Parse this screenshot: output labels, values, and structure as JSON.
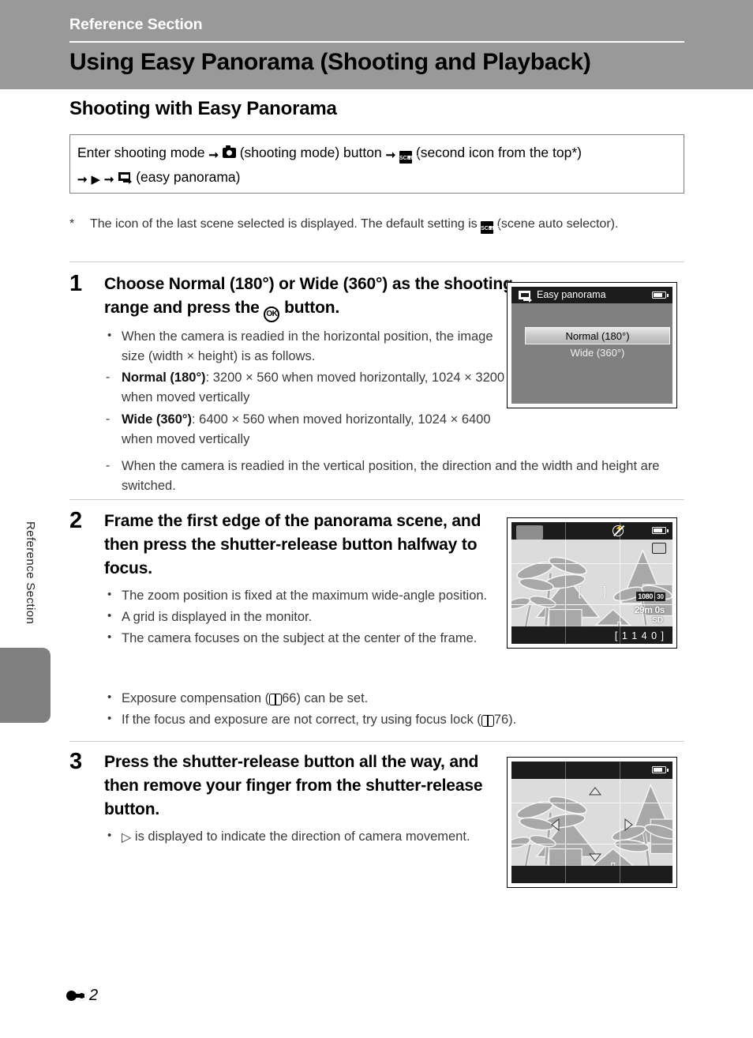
{
  "header": {
    "kicker": "Reference Section",
    "title": "Using Easy Panorama (Shooting and Playback)"
  },
  "section_heading": "Shooting with Easy Panorama",
  "nav_box": {
    "line1_part1": "Enter shooting mode",
    "line1_part2": "(shooting mode) button",
    "line1_part3": "(second icon from the top*)",
    "line2_part1": "(easy panorama)",
    "icons": [
      "arrow-right-icon",
      "camera-icon",
      "arrow-right-icon",
      "scene-icon",
      "arrow-right-icon",
      "play-triangle-icon",
      "arrow-right-icon",
      "easy-panorama-icon"
    ]
  },
  "footnote": {
    "marker": "*",
    "text_before": "The icon of the last scene selected is displayed. The default setting is",
    "text_after": "(scene auto selector)."
  },
  "steps": [
    {
      "number": "1",
      "title_parts": [
        "Choose ",
        "Normal (180°)",
        " or ",
        "Wide (360°)",
        " as the shooting range and press the ",
        "OK",
        " button."
      ],
      "bullets": [
        {
          "marker": "•",
          "text": "When the camera is readied in the horizontal position, the image size (width × height) is as follows."
        },
        {
          "marker": "-",
          "bold": "Normal (180°)",
          "text": ": 3200 × 560 when moved horizontally, 1024 × 3200 when moved vertically"
        },
        {
          "marker": "-",
          "bold": "Wide (360°)",
          "text": ": 6400 × 560 when moved horizontally, 1024 × 6400 when moved vertically"
        },
        {
          "marker": "-",
          "text": "When the camera is readied in the vertical position, the direction and the width and height are switched."
        }
      ],
      "screen": {
        "type": "menu",
        "title": "Easy panorama",
        "title_icon": "easy-panorama-icon",
        "battery_icon": "battery-icon",
        "options": [
          {
            "label": "Normal (180°)",
            "selected": true
          },
          {
            "label": "Wide (360°)",
            "selected": false
          }
        ]
      }
    },
    {
      "number": "2",
      "title_parts": [
        "Frame the first edge of the panorama scene, and then press the shutter-release button halfway to focus."
      ],
      "bullets": [
        {
          "marker": "•",
          "text": "The zoom position is fixed at the maximum wide-angle position."
        },
        {
          "marker": "•",
          "text": "A grid is displayed in the monitor."
        },
        {
          "marker": "•",
          "text": "The camera focuses on the subject at the center of the frame."
        },
        {
          "marker": "•",
          "text_before": "Exposure compensation (",
          "ref": "66",
          "text_after": ") can be set."
        },
        {
          "marker": "•",
          "text_before": "If the focus and exposure are not correct, try using focus lock (",
          "ref": "76",
          "text_after": ")."
        }
      ],
      "screen": {
        "type": "liveview",
        "mode_icon": "easy-panorama-icon",
        "flash_icon": "flash-off-icon",
        "battery_icon": "battery-icon",
        "vr_icon": "vibration-reduction-icon",
        "af_brackets": "[    ]",
        "movie_quality": "1080",
        "movie_fps": "30",
        "rec_time": "29m 0s",
        "card_label": "SD",
        "shots_remaining": "[ 1 1 4 0 ]"
      }
    },
    {
      "number": "3",
      "title_parts": [
        "Press the shutter-release button all the way, and then remove your finger from the shutter-release button."
      ],
      "bullets": [
        {
          "marker": "•",
          "icon": "direction-triangle-icon",
          "text": " is displayed to indicate the direction of camera movement."
        }
      ],
      "screen": {
        "type": "liveview-direction",
        "battery_icon": "battery-icon",
        "direction_arrows": [
          "up-arrow-icon",
          "down-arrow-icon",
          "left-arrow-icon",
          "right-arrow-icon"
        ]
      }
    }
  ],
  "side_label": "Reference Section",
  "footer": {
    "mark": "reference-e-icon",
    "page": "2"
  },
  "colors": {
    "header_band": "#999999",
    "separator": "#cccccc",
    "side_tab": "#808080",
    "screen_bg": "#808080",
    "lcd_dark": "#1c1c1c"
  }
}
